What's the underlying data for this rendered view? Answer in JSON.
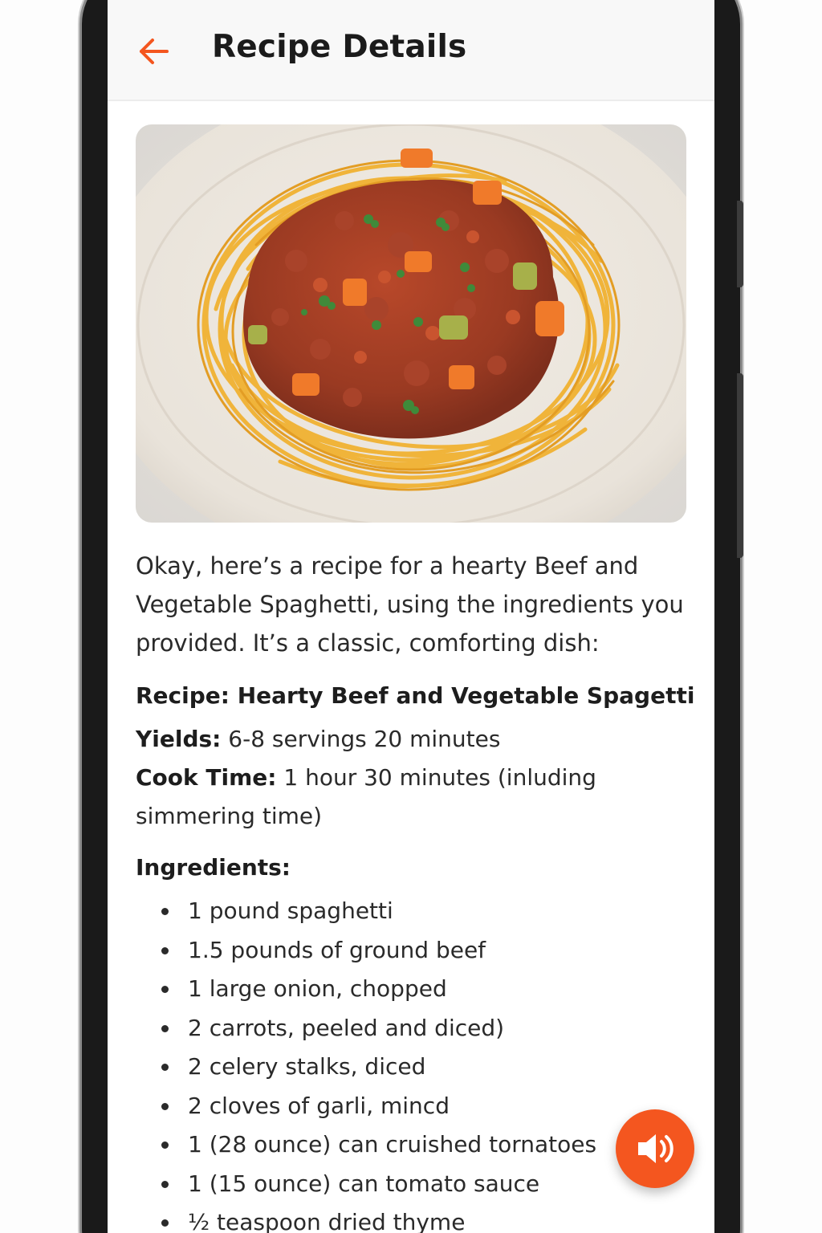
{
  "header": {
    "title": "Recipe Details",
    "back_icon": "arrow-left-icon",
    "accent_color": "#f4561f"
  },
  "hero_image": {
    "subject": "spaghetti with beef and vegetable sauce"
  },
  "intro": "Okay, here’s a recipe for a hearty Beef and Vegetable Spaghetti, using the ingredients you provided. It’s a classic, comforting dish:",
  "recipe": {
    "title": "Recipe: Hearty Beef and Vegetable Spagetti",
    "yields_label": "Yields:",
    "yields_value": " 6-8 servings  20 minutes",
    "cook_time_label": "Cook Time:",
    "cook_time_value": " 1 hour 30 minutes (inluding simmering time)"
  },
  "ingredients": {
    "title": "Ingredients:",
    "items": [
      "1 pound spaghetti",
      "1.5 pounds of ground beef",
      "1 large onion, chopped",
      "2 carrots, peeled and diced)",
      "2 celery stalks, diced",
      "2 cloves of garli, mincd",
      "1 (28 ounce) can cruished tornatoes",
      "1 (15 ounce) can tomato sauce",
      "½ teaspoon dried thyme"
    ]
  },
  "fab": {
    "icon": "speaker-icon",
    "color": "#f4561f"
  }
}
